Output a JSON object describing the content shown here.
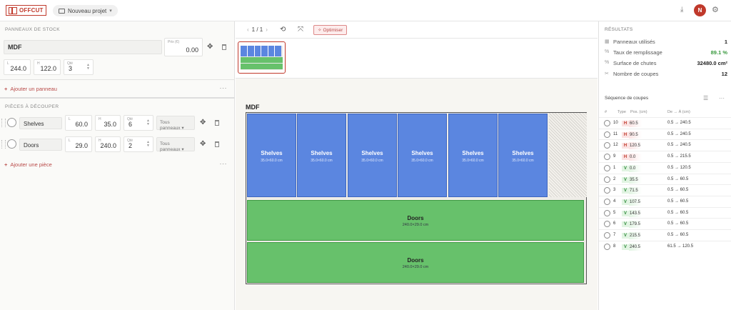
{
  "app": {
    "logo_text": "OFFCUT",
    "project_label": "Nouveau projet",
    "avatar_initial": "N",
    "accent": "#c0392b"
  },
  "left": {
    "stock_title": "PANNEAUX DE STOCK",
    "stock": {
      "name": "MDF",
      "price_label": "Prix (€)",
      "price": "0.00",
      "length_label": "L",
      "length": "244.0",
      "height_label": "H",
      "height": "122.0",
      "qty_label": "Qté",
      "qty": "3"
    },
    "add_panel": "Ajouter un panneau",
    "pieces_title": "PIÈCES À DÉCOUPER",
    "pieces": [
      {
        "name": "Shelves",
        "l_label": "L",
        "l": "60.0",
        "h_label": "H",
        "h": "35.0",
        "qty_label": "Qté",
        "qty": "6",
        "panels": "Tous panneaux"
      },
      {
        "name": "Doors",
        "l_label": "L",
        "l": "29.0",
        "h_label": "H",
        "h": "240.0",
        "qty_label": "Qté",
        "qty": "2",
        "panels": "Tous panneaux"
      }
    ],
    "add_piece": "Ajouter une pièce"
  },
  "center": {
    "pager": "1 / 1",
    "optimize_label": "Optimiser",
    "board_title": "MDF",
    "shelves": [
      {
        "name": "Shelves",
        "dim": "35.0×60.0 cm"
      },
      {
        "name": "Shelves",
        "dim": "35.0×60.0 cm"
      },
      {
        "name": "Shelves",
        "dim": "35.0×60.0 cm"
      },
      {
        "name": "Shelves",
        "dim": "35.0×60.0 cm"
      },
      {
        "name": "Shelves",
        "dim": "35.0×60.0 cm"
      },
      {
        "name": "Shelves",
        "dim": "35.0×60.0 cm"
      }
    ],
    "doors": [
      {
        "name": "Doors",
        "dim": "240.0×29.0 cm"
      },
      {
        "name": "Doors",
        "dim": "240.0×29.0 cm"
      }
    ],
    "colors": {
      "shelf": "#5b86e0",
      "door": "#67c16b"
    }
  },
  "right": {
    "results_title": "RÉSULTATS",
    "stats": [
      {
        "icon": "panel-icon",
        "label": "Panneaux utilisés",
        "value": "1"
      },
      {
        "icon": "percent-icon",
        "label": "Taux de remplissage",
        "value": "89.1 %"
      },
      {
        "icon": "percent-icon",
        "label": "Surface de chutes",
        "value": "32480.0 cm²"
      },
      {
        "icon": "scissors-icon",
        "label": "Nombre de coupes",
        "value": "12"
      }
    ],
    "sequence_title": "Séquence de coupes",
    "table_headers": {
      "num": "#",
      "type": "Type",
      "pos": "Pos. (cm)",
      "range": "De → À (cm)"
    },
    "cuts": [
      {
        "n": "10",
        "type": "H",
        "pos": "60.5",
        "range": "0.5 → 240.5"
      },
      {
        "n": "11",
        "type": "H",
        "pos": "90.5",
        "range": "0.5 → 240.5"
      },
      {
        "n": "12",
        "type": "H",
        "pos": "120.5",
        "range": "0.5 → 240.5"
      },
      {
        "n": "9",
        "type": "H",
        "pos": "0.0",
        "range": "0.5 → 215.5"
      },
      {
        "n": "1",
        "type": "V",
        "pos": "0.0",
        "range": "0.5 → 120.5"
      },
      {
        "n": "2",
        "type": "V",
        "pos": "35.5",
        "range": "0.5 → 60.5"
      },
      {
        "n": "3",
        "type": "V",
        "pos": "71.5",
        "range": "0.5 → 60.5"
      },
      {
        "n": "4",
        "type": "V",
        "pos": "107.5",
        "range": "0.5 → 60.5"
      },
      {
        "n": "5",
        "type": "V",
        "pos": "143.5",
        "range": "0.5 → 60.5"
      },
      {
        "n": "6",
        "type": "V",
        "pos": "179.5",
        "range": "0.5 → 60.5"
      },
      {
        "n": "7",
        "type": "V",
        "pos": "215.5",
        "range": "0.5 → 60.5"
      },
      {
        "n": "8",
        "type": "V",
        "pos": "240.5",
        "range": "61.5 → 120.5"
      }
    ]
  }
}
